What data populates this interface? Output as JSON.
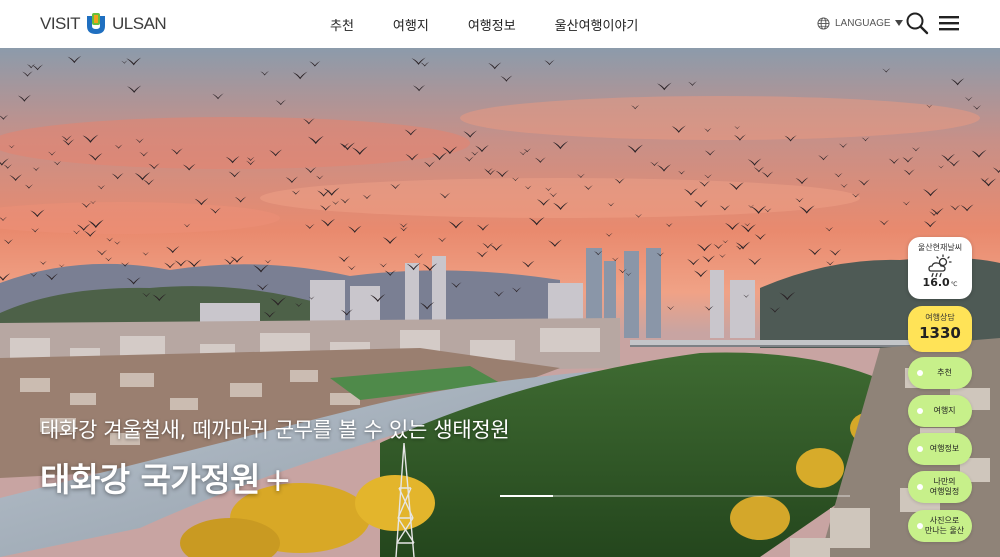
{
  "header": {
    "logo_left": "VISIT",
    "logo_right": "ULSAN",
    "nav": [
      "추천",
      "여행지",
      "여행정보",
      "울산여행이야기"
    ],
    "language_label": "LANGUAGE"
  },
  "hero": {
    "subtitle": "태화강 겨울철새, 떼까마귀 군무를 볼 수 있는 생태정원",
    "title": "태화강 국가정원",
    "title_plus": "+",
    "slide_progress": 0.15
  },
  "widgets": {
    "weather_label": "울산현재날씨",
    "weather_icon": "partly-cloudy-rain-icon",
    "weather_temp": "16.0",
    "weather_unit": "℃",
    "consult_label": "여행상담",
    "consult_number": "1330",
    "quick_links": [
      "추천",
      "여행지",
      "여행정보",
      "나만의\n여행일정",
      "사진으로\n만나는 울산"
    ]
  },
  "colors": {
    "consult_bg": "#ffe357",
    "quick_link_bg": "#c7f08a",
    "logo_blue": "#1f6fc0",
    "logo_green": "#6abf3a"
  }
}
